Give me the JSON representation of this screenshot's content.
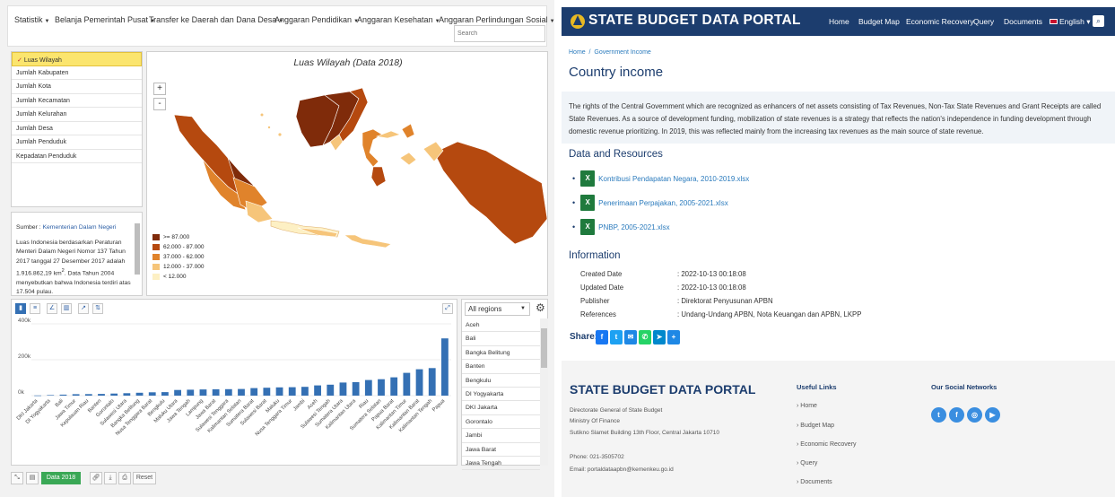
{
  "left": {
    "nav": [
      {
        "label": "Statistik"
      },
      {
        "label": "Belanja Pemerintah Pusat"
      },
      {
        "label": "Transfer ke Daerah dan Dana Desa"
      },
      {
        "label": "Anggaran Pendidikan"
      },
      {
        "label": "Anggaran Kesehatan"
      },
      {
        "label": "Anggaran Perlindungan Sosial"
      }
    ],
    "search_placeholder": "Search",
    "indicators": [
      "Luas Wilayah",
      "Jumlah Kabupaten",
      "Jumlah Kota",
      "Jumlah Kecamatan",
      "Jumlah Kelurahan",
      "Jumlah Desa",
      "Jumlah Penduduk",
      "Kepadatan Penduduk"
    ],
    "selected_indicator": "Luas Wilayah",
    "source_prefix": "Sumber : ",
    "source_link": "Kementerian Dalam Negeri",
    "source_text_1": "Luas Indonesia berdasarkan Peraturan Menteri Dalam Negeri Nomor 137 Tahun 2017 tanggal 27 Desember 2017 adalah 1.916.862,19 km",
    "source_sup": "2",
    "source_text_2": ". Data Tahun 2004 menyebutkan bahwa Indonesia terdiri atas 17.504 pulau.",
    "map_title": "Luas Wilayah (Data 2018)",
    "zoom_in": "+",
    "zoom_out": "-",
    "legend": [
      {
        "label": ">= 87.000",
        "color": "#7f2b0a"
      },
      {
        "label": "62.000 - 87.000",
        "color": "#b5490f"
      },
      {
        "label": "37.000 - 62.000",
        "color": "#e0832b"
      },
      {
        "label": "12.000 - 37.000",
        "color": "#f6c57a"
      },
      {
        "label": "< 12.000",
        "color": "#fdf0c4"
      }
    ],
    "region_select": "All regions",
    "regions": [
      "Aceh",
      "Bali",
      "Bangka Belitung",
      "Banten",
      "Bengkulu",
      "DI Yogyakarta",
      "DKI Jakarta",
      "Gorontalo",
      "Jambi",
      "Jawa Barat",
      "Jawa Tengah"
    ],
    "year_badge": "Data 2018",
    "reset_label": "Reset"
  },
  "chart_data": {
    "type": "bar",
    "categories": [
      "DKI Jakarta",
      "DI Yogyakarta",
      "Bali",
      "Jawa Timur",
      "Kepulauan Riau",
      "Banten",
      "Gorontalo",
      "Sulawesi Utara",
      "Bangka Belitung",
      "Nusa Tenggara Barat",
      "Bengkulu",
      "Maluku Utara",
      "Jawa Tengah",
      "Lampung",
      "Jawa Barat",
      "Sulawesi Tenggara",
      "Kalimantan Selatan",
      "Sumatera Barat",
      "Sulawesi Barat",
      "Maluku",
      "Nusa Tenggara Timur",
      "Jambi",
      "Aceh",
      "Sulawesi Tengah",
      "Sumatera Utara",
      "Kalimantan Utara",
      "Riau",
      "Sumatera Selatan",
      "Papua Barat",
      "Kalimantan Timur",
      "Kalimantan Barat",
      "Kalimantan Tengah",
      "Papua"
    ],
    "values": [
      1000,
      3000,
      5500,
      8000,
      8500,
      9500,
      11500,
      13500,
      16000,
      18500,
      19500,
      31500,
      33000,
      34500,
      35500,
      36000,
      37000,
      42000,
      44000,
      46000,
      47000,
      49000,
      57000,
      61000,
      73000,
      75000,
      87000,
      91500,
      102000,
      127000,
      147000,
      153500,
      319000
    ],
    "yticks": [
      "0k",
      "200k",
      "400k"
    ],
    "ylim": [
      0,
      400000
    ],
    "color": "#3470b4"
  },
  "right": {
    "brand": "STATE BUDGET DATA PORTAL",
    "nav": [
      "Home",
      "Budget Map",
      "Economic Recovery",
      "Query",
      "Documents",
      "English"
    ],
    "breadcrumb": "Home  /  Government Income",
    "title": "Country income",
    "description": "The rights of the Central Government which are recognized as enhancers of net assets consisting of Tax Revenues, Non-Tax State Revenues and Grant Receipts are called State Revenues. As a source of development funding, mobilization of state revenues is a strategy that reflects the nation's independence in funding development through domestic revenue prioritizing. In 2019, this was reflected mainly from the increasing tax revenues as the main source of state revenue.",
    "resources_title": "Data and Resources",
    "resources": [
      "Kontribusi Pendapatan Negara, 2010-2019.xlsx",
      "Penerimaan Perpajakan, 2005-2021.xlsx",
      "PNBP, 2005-2021.xlsx"
    ],
    "info_title": "Information",
    "info": [
      {
        "k": "Created Date",
        "v": ": 2022-10-13 00:18:08"
      },
      {
        "k": "Updated Date",
        "v": ": 2022-10-13 00:18:08"
      },
      {
        "k": "Publisher",
        "v": ": Direktorat Penyusunan APBN"
      },
      {
        "k": "References",
        "v": ": Undang-Undang APBN, Nota Keuangan dan APBN, LKPP"
      }
    ],
    "share_label": "Share:",
    "footer": {
      "brand": "STATE BUDGET DATA PORTAL",
      "addr": [
        "Directorate General of State Budget",
        "Ministry Of Finance",
        "Sutikno Slamet Building 13th Floor, Central Jakarta 10710"
      ],
      "phone": "Phone: 021-3505702",
      "email": "Email: portaldataapbn@kemenkeu.go.id",
      "useful_title": "Useful Links",
      "links": [
        "Home",
        "Budget Map",
        "Economic Recovery",
        "Query",
        "Documents"
      ],
      "social_title": "Our Social Networks"
    }
  }
}
